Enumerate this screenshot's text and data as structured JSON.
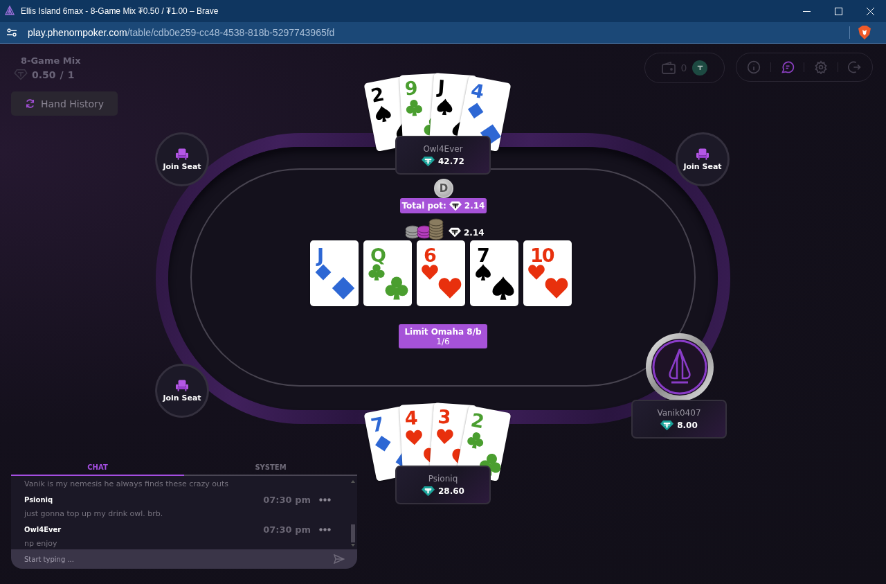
{
  "window": {
    "title": "Ellis Island 6max - 8-Game Mix ₮0.50 / ₮1.00 – Brave"
  },
  "address_bar": {
    "host": "play.phenompoker.com",
    "path": "/table/cdb0e259-cc48-4538-818b-5297743965fd"
  },
  "game_info": {
    "name": "8-Game Mix",
    "small_blind": "0.50",
    "separator": "/",
    "big_blind": "1"
  },
  "hand_history_button": {
    "label": "Hand History"
  },
  "wallet": {
    "balance": "0"
  },
  "toolbar": [
    {
      "kind": "info",
      "selected": false
    },
    {
      "kind": "chat",
      "selected": true
    },
    {
      "kind": "settings",
      "selected": false
    },
    {
      "kind": "exit",
      "selected": false
    }
  ],
  "seats": [
    {
      "kind": "empty",
      "label": "Join Seat"
    },
    {
      "kind": "player",
      "name": "Owl4Ever",
      "stack": "42.72",
      "cards": [
        {
          "rank": "2",
          "kind": "spades"
        },
        {
          "rank": "9",
          "kind": "clubs"
        },
        {
          "rank": "J",
          "kind": "spades"
        },
        {
          "rank": "4",
          "kind": "diamonds"
        }
      ]
    },
    {
      "kind": "empty",
      "label": "Join Seat"
    },
    {
      "kind": "player",
      "name": "Vanik0407",
      "stack": "8.00"
    },
    {
      "kind": "player",
      "name": "Psioniq",
      "stack": "28.60",
      "cards": [
        {
          "rank": "7",
          "kind": "diamonds"
        },
        {
          "rank": "4",
          "kind": "hearts"
        },
        {
          "rank": "3",
          "kind": "hearts"
        },
        {
          "rank": "2",
          "kind": "clubs"
        }
      ]
    },
    {
      "kind": "empty",
      "label": "Join Seat"
    }
  ],
  "dealer_button": {
    "label": "D"
  },
  "pot": {
    "label": "Total pot:",
    "amount": "2.14"
  },
  "bet": {
    "amount": "2.14"
  },
  "board": [
    {
      "rank": "J",
      "kind": "diamonds"
    },
    {
      "rank": "Q",
      "kind": "clubs"
    },
    {
      "rank": "6",
      "kind": "hearts"
    },
    {
      "rank": "7",
      "kind": "spades"
    },
    {
      "rank": "10",
      "kind": "hearts"
    }
  ],
  "game_label": {
    "name": "Limit Omaha 8/b",
    "hand": "1/6"
  },
  "chat": {
    "tabs": [
      {
        "label": "CHAT",
        "selected": true
      },
      {
        "label": "SYSTEM",
        "selected": false
      }
    ],
    "messages": [
      {
        "text": "Vanik is my nemesis he always finds these crazy outs"
      },
      {
        "author": "Psioniq",
        "time": "07:30 pm",
        "text": "just gonna top up my drink owl. brb."
      },
      {
        "author": "Owl4Ever",
        "time": "07:30 pm",
        "text": "np enjoy"
      }
    ],
    "input": {
      "placeholder": "Start typing ..."
    }
  }
}
